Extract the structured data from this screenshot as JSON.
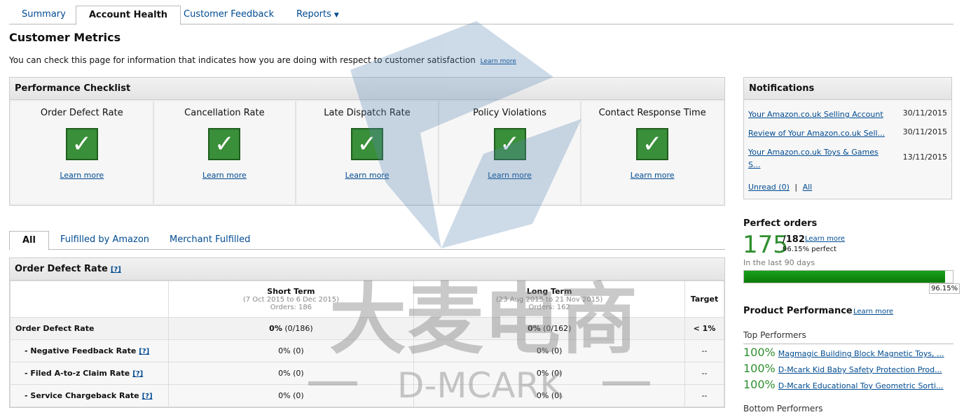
{
  "top_tabs": [
    {
      "label": "Summary"
    },
    {
      "label": "Account Health"
    },
    {
      "label": "Customer Feedback"
    },
    {
      "label": "Reports",
      "caret": "▼"
    }
  ],
  "page": {
    "title": "Customer Metrics",
    "description": "You can check this page for information that indicates how you are doing with respect to customer satisfaction",
    "learn_more": "Learn more"
  },
  "checklist": {
    "title": "Performance Checklist",
    "items": [
      {
        "label": "Order Defect Rate",
        "link": "Learn more"
      },
      {
        "label": "Cancellation Rate",
        "link": "Learn more"
      },
      {
        "label": "Late Dispatch Rate",
        "link": "Learn more"
      },
      {
        "label": "Policy Violations",
        "link": "Learn more"
      },
      {
        "label": "Contact Response Time",
        "link": "Learn more"
      }
    ],
    "check_glyph": "✓",
    "status_color": "#3a8f3a"
  },
  "notifications": {
    "title": "Notifications",
    "items": [
      {
        "text": "Your Amazon.co.uk Selling Account",
        "date": "30/11/2015"
      },
      {
        "text": "Review of Your Amazon.co.uk Sell...",
        "date": "30/11/2015"
      },
      {
        "text": "Your Amazon.co.uk Toys & Games S...",
        "date": "13/11/2015"
      }
    ],
    "unread": "Unread (0)",
    "separator": "|",
    "all": "All"
  },
  "perfect_orders": {
    "title": "Perfect orders",
    "count": "175",
    "total": "/182",
    "learn_more": "Learn more",
    "percent_text": "96.15% perfect",
    "period": "In the last 90 days",
    "bar_percent": 96.15,
    "badge": "96.15%"
  },
  "product_performance": {
    "title": "Product Performance",
    "learn_more": "Learn more",
    "top_label": "Top Performers",
    "top": [
      {
        "pct": "100%",
        "name": "Magmagic Building Block Magnetic Toys, ..."
      },
      {
        "pct": "100%",
        "name": "D-Mcark Kid Baby Safety Protection Prod..."
      },
      {
        "pct": "100%",
        "name": "D-Mcark Educational Toy Geometric Sorti..."
      }
    ],
    "bottom_label": "Bottom Performers"
  },
  "sub_tabs": [
    {
      "label": "All"
    },
    {
      "label": "Fulfilled by Amazon"
    },
    {
      "label": "Merchant Fulfilled"
    }
  ],
  "odr": {
    "title": "Order Defect Rate",
    "help": "[?]",
    "columns": {
      "short": {
        "title": "Short Term",
        "range": "(7 Oct 2015 to 6 Dec 2015)",
        "orders": "Orders: 186"
      },
      "long": {
        "title": "Long Term",
        "range": "(23 Aug 2015 to 21 Nov 2015)",
        "orders": "Orders: 162"
      },
      "target": "Target"
    },
    "rows": [
      {
        "label": "Order Defect Rate",
        "short_pct": "0%",
        "short_cnt": " (0/186)",
        "long_pct": "0%",
        "long_cnt": " (0/162)",
        "target": "< 1%"
      },
      {
        "label": "- Negative Feedback Rate",
        "help": "[?]",
        "short": "0% (0)",
        "long": "0% (0)",
        "target": "--"
      },
      {
        "label": "- Filed A-to-z Claim Rate",
        "help": "[?]",
        "short": "0% (0)",
        "long": "0% (0)",
        "target": "--"
      },
      {
        "label": "- Service Chargeback Rate",
        "help": "[?]",
        "short": "0% (0)",
        "long": "0% (0)",
        "target": "--"
      }
    ]
  },
  "watermark": {
    "text_cn": "大麦电商",
    "text_en": "D-MCARK"
  }
}
